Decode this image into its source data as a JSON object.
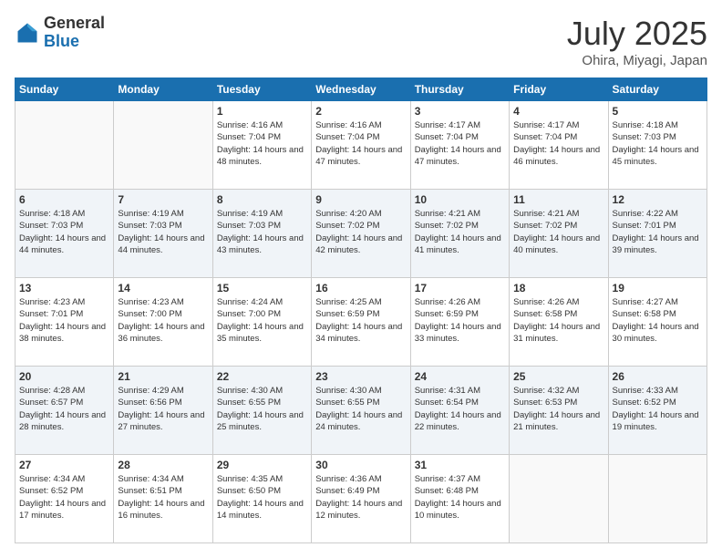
{
  "header": {
    "logo_general": "General",
    "logo_blue": "Blue",
    "month": "July 2025",
    "location": "Ohira, Miyagi, Japan"
  },
  "weekdays": [
    "Sunday",
    "Monday",
    "Tuesday",
    "Wednesday",
    "Thursday",
    "Friday",
    "Saturday"
  ],
  "weeks": [
    [
      {
        "day": "",
        "empty": true
      },
      {
        "day": "",
        "empty": true
      },
      {
        "day": "1",
        "sunrise": "4:16 AM",
        "sunset": "7:04 PM",
        "daylight": "14 hours and 48 minutes."
      },
      {
        "day": "2",
        "sunrise": "4:16 AM",
        "sunset": "7:04 PM",
        "daylight": "14 hours and 47 minutes."
      },
      {
        "day": "3",
        "sunrise": "4:17 AM",
        "sunset": "7:04 PM",
        "daylight": "14 hours and 47 minutes."
      },
      {
        "day": "4",
        "sunrise": "4:17 AM",
        "sunset": "7:04 PM",
        "daylight": "14 hours and 46 minutes."
      },
      {
        "day": "5",
        "sunrise": "4:18 AM",
        "sunset": "7:03 PM",
        "daylight": "14 hours and 45 minutes."
      }
    ],
    [
      {
        "day": "6",
        "sunrise": "4:18 AM",
        "sunset": "7:03 PM",
        "daylight": "14 hours and 44 minutes."
      },
      {
        "day": "7",
        "sunrise": "4:19 AM",
        "sunset": "7:03 PM",
        "daylight": "14 hours and 44 minutes."
      },
      {
        "day": "8",
        "sunrise": "4:19 AM",
        "sunset": "7:03 PM",
        "daylight": "14 hours and 43 minutes."
      },
      {
        "day": "9",
        "sunrise": "4:20 AM",
        "sunset": "7:02 PM",
        "daylight": "14 hours and 42 minutes."
      },
      {
        "day": "10",
        "sunrise": "4:21 AM",
        "sunset": "7:02 PM",
        "daylight": "14 hours and 41 minutes."
      },
      {
        "day": "11",
        "sunrise": "4:21 AM",
        "sunset": "7:02 PM",
        "daylight": "14 hours and 40 minutes."
      },
      {
        "day": "12",
        "sunrise": "4:22 AM",
        "sunset": "7:01 PM",
        "daylight": "14 hours and 39 minutes."
      }
    ],
    [
      {
        "day": "13",
        "sunrise": "4:23 AM",
        "sunset": "7:01 PM",
        "daylight": "14 hours and 38 minutes."
      },
      {
        "day": "14",
        "sunrise": "4:23 AM",
        "sunset": "7:00 PM",
        "daylight": "14 hours and 36 minutes."
      },
      {
        "day": "15",
        "sunrise": "4:24 AM",
        "sunset": "7:00 PM",
        "daylight": "14 hours and 35 minutes."
      },
      {
        "day": "16",
        "sunrise": "4:25 AM",
        "sunset": "6:59 PM",
        "daylight": "14 hours and 34 minutes."
      },
      {
        "day": "17",
        "sunrise": "4:26 AM",
        "sunset": "6:59 PM",
        "daylight": "14 hours and 33 minutes."
      },
      {
        "day": "18",
        "sunrise": "4:26 AM",
        "sunset": "6:58 PM",
        "daylight": "14 hours and 31 minutes."
      },
      {
        "day": "19",
        "sunrise": "4:27 AM",
        "sunset": "6:58 PM",
        "daylight": "14 hours and 30 minutes."
      }
    ],
    [
      {
        "day": "20",
        "sunrise": "4:28 AM",
        "sunset": "6:57 PM",
        "daylight": "14 hours and 28 minutes."
      },
      {
        "day": "21",
        "sunrise": "4:29 AM",
        "sunset": "6:56 PM",
        "daylight": "14 hours and 27 minutes."
      },
      {
        "day": "22",
        "sunrise": "4:30 AM",
        "sunset": "6:55 PM",
        "daylight": "14 hours and 25 minutes."
      },
      {
        "day": "23",
        "sunrise": "4:30 AM",
        "sunset": "6:55 PM",
        "daylight": "14 hours and 24 minutes."
      },
      {
        "day": "24",
        "sunrise": "4:31 AM",
        "sunset": "6:54 PM",
        "daylight": "14 hours and 22 minutes."
      },
      {
        "day": "25",
        "sunrise": "4:32 AM",
        "sunset": "6:53 PM",
        "daylight": "14 hours and 21 minutes."
      },
      {
        "day": "26",
        "sunrise": "4:33 AM",
        "sunset": "6:52 PM",
        "daylight": "14 hours and 19 minutes."
      }
    ],
    [
      {
        "day": "27",
        "sunrise": "4:34 AM",
        "sunset": "6:52 PM",
        "daylight": "14 hours and 17 minutes."
      },
      {
        "day": "28",
        "sunrise": "4:34 AM",
        "sunset": "6:51 PM",
        "daylight": "14 hours and 16 minutes."
      },
      {
        "day": "29",
        "sunrise": "4:35 AM",
        "sunset": "6:50 PM",
        "daylight": "14 hours and 14 minutes."
      },
      {
        "day": "30",
        "sunrise": "4:36 AM",
        "sunset": "6:49 PM",
        "daylight": "14 hours and 12 minutes."
      },
      {
        "day": "31",
        "sunrise": "4:37 AM",
        "sunset": "6:48 PM",
        "daylight": "14 hours and 10 minutes."
      },
      {
        "day": "",
        "empty": true
      },
      {
        "day": "",
        "empty": true
      }
    ]
  ]
}
